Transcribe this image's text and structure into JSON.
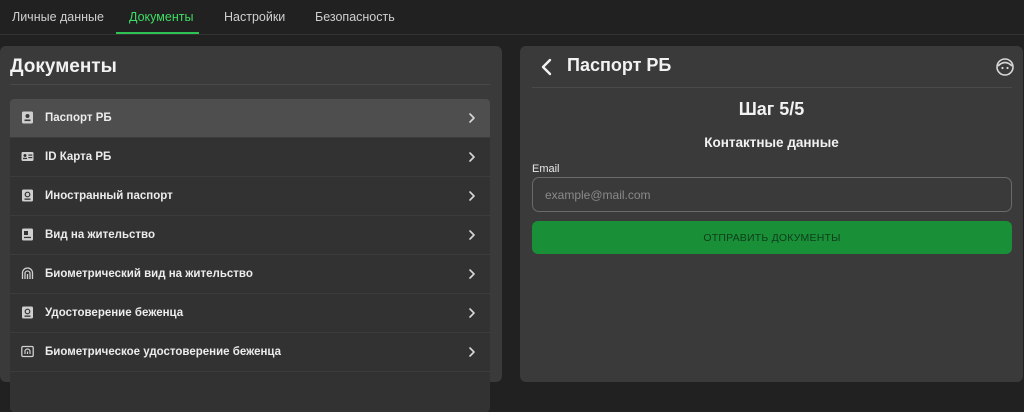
{
  "tabs": [
    {
      "label": "Личные данные"
    },
    {
      "label": "Документы"
    },
    {
      "label": "Настройки"
    },
    {
      "label": "Безопасность"
    }
  ],
  "accent_color": "#3ddc64",
  "left_panel": {
    "title": "Документы",
    "items": [
      {
        "label": "Паспорт РБ",
        "icon": "passport-icon"
      },
      {
        "label": "ID Карта РБ",
        "icon": "id-card-icon"
      },
      {
        "label": "Иностранный паспорт",
        "icon": "passport-icon"
      },
      {
        "label": "Вид на жительство",
        "icon": "residence-card-icon"
      },
      {
        "label": "Биометрический вид на жительство",
        "icon": "biometric-card-icon"
      },
      {
        "label": "Удостоверение беженца",
        "icon": "passport-icon"
      },
      {
        "label": "Биометрическое удостоверение беженца",
        "icon": "biometric-card-icon"
      }
    ]
  },
  "right_panel": {
    "title": "Паспорт РБ",
    "step": "Шаг 5/5",
    "subtitle": "Контактные данные",
    "email_label": "Email",
    "email_placeholder": "example@mail.com",
    "email_value": "",
    "submit_label": "ОТПРАВИТЬ ДОКУМЕНТЫ",
    "submit_color": "#198f38"
  }
}
